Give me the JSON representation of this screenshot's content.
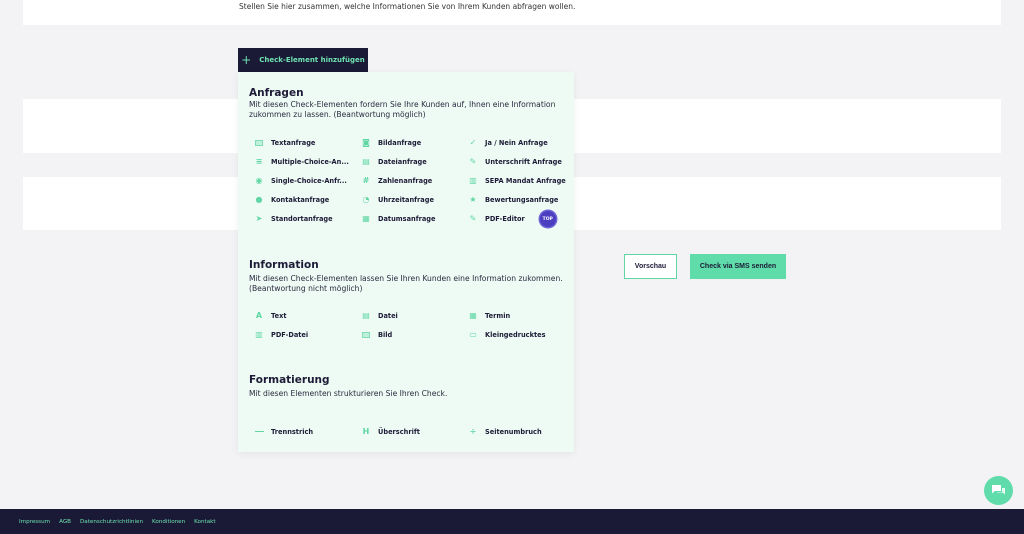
{
  "intro_text": "Stellen Sie hier zusammen, welche Informationen Sie von Ihrem Kunden abfragen wollen.",
  "add_button": {
    "icon": "plus-icon",
    "label": "Check-Element hinzufügen"
  },
  "sections": {
    "anfragen": {
      "title": "Anfragen",
      "description": "Mit diesen Check-Elementen fordern Sie Ihre Kunden auf, Ihnen eine Information zukommen zu lassen. (Beantwortung möglich)",
      "items": [
        {
          "label": "Textanfrage",
          "icon": "text-field-icon"
        },
        {
          "label": "Bildanfrage",
          "icon": "camera-icon"
        },
        {
          "label": "Ja / Nein Anfrage",
          "icon": "check-icon"
        },
        {
          "label": "Multiple-Choice-An...",
          "icon": "list-icon"
        },
        {
          "label": "Dateianfrage",
          "icon": "file-upload-icon"
        },
        {
          "label": "Unterschrift Anfrage",
          "icon": "pen-icon"
        },
        {
          "label": "Single-Choice-Anfr...",
          "icon": "radio-icon"
        },
        {
          "label": "Zahlenanfrage",
          "icon": "number-icon"
        },
        {
          "label": "SEPA Mandat Anfrage",
          "icon": "document-icon"
        },
        {
          "label": "Kontaktanfrage",
          "icon": "person-icon"
        },
        {
          "label": "Uhrzeitanfrage",
          "icon": "clock-icon"
        },
        {
          "label": "Bewertungsanfrage",
          "icon": "star-icon"
        },
        {
          "label": "Standortanfrage",
          "icon": "location-arrow-icon"
        },
        {
          "label": "Datumsanfrage",
          "icon": "calendar-icon"
        },
        {
          "label": "PDF-Editor",
          "icon": "pen-icon",
          "badge": "TOP"
        }
      ]
    },
    "information": {
      "title": "Information",
      "description": "Mit diesen Check-Elementen lassen Sie Ihren Kunden eine Information zukommen. (Beantwortung nicht möglich)",
      "items": [
        {
          "label": "Text",
          "icon": "text-icon"
        },
        {
          "label": "Datei",
          "icon": "file-icon"
        },
        {
          "label": "Termin",
          "icon": "calendar-icon"
        },
        {
          "label": "PDF-Datei",
          "icon": "pdf-icon"
        },
        {
          "label": "Bild",
          "icon": "image-icon"
        },
        {
          "label": "Kleingedrucktes",
          "icon": "small-print-icon"
        }
      ]
    },
    "formatierung": {
      "title": "Formatierung",
      "description": "Mit diesen Elementen strukturieren Sie Ihren Check.",
      "items": [
        {
          "label": "Trennstrich",
          "icon": "divider-icon"
        },
        {
          "label": "Überschrift",
          "icon": "heading-icon"
        },
        {
          "label": "Seitenumbruch",
          "icon": "page-break-icon"
        }
      ]
    }
  },
  "actions": {
    "preview": "Vorschau",
    "send": "Check via SMS senden"
  },
  "chat": {
    "icon": "chat-icon"
  },
  "footer": {
    "links": [
      "Impressum",
      "AGB",
      "Datenschutzrichtlinien",
      "Konditionen",
      "Kontakt"
    ]
  },
  "colors": {
    "accent": "#5fdcaa",
    "dark": "#1b1a36",
    "panel": "#eefbf4",
    "badge": "#4b3fbf"
  }
}
